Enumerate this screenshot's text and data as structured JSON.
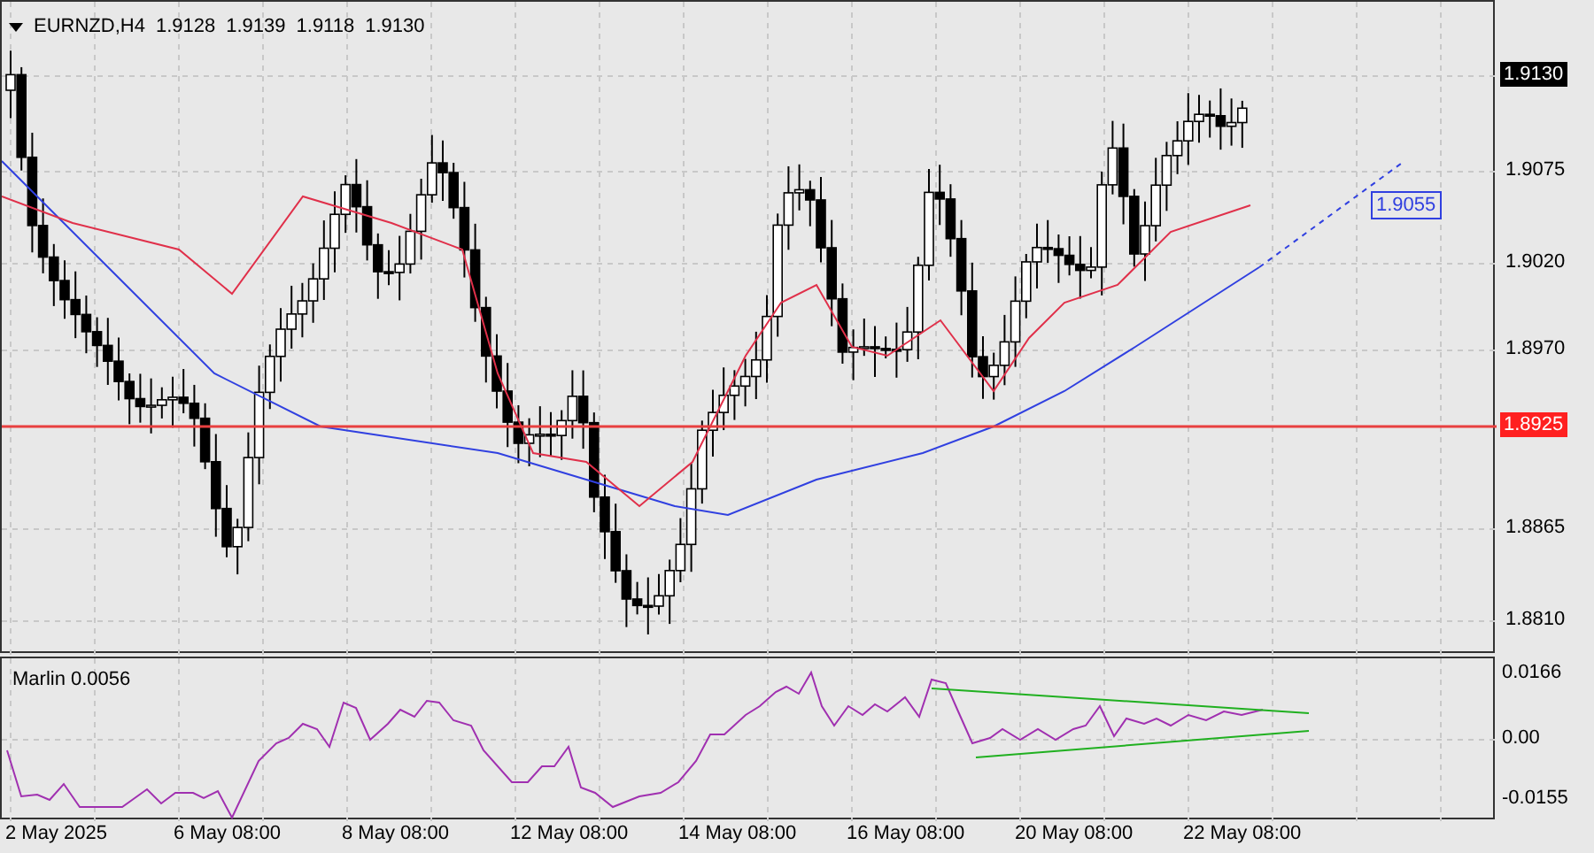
{
  "header": {
    "symbol": "EURNZD,H4",
    "ohlc": [
      "1.9128",
      "1.9139",
      "1.9118",
      "1.9130"
    ]
  },
  "price_axis": [
    "1.9075",
    "1.9020",
    "1.8970",
    "1.8865",
    "1.8810"
  ],
  "current_price": "1.9130",
  "level_line": {
    "label": "1.8925"
  },
  "trendline": {
    "label": "1.9055"
  },
  "indicator": {
    "label": "Marlin 0.0056",
    "axis": [
      "0.0166",
      "0.00",
      "-0.0155"
    ]
  },
  "time_axis": [
    "2 May 2025",
    "6 May 08:00",
    "8 May 08:00",
    "12 May 08:00",
    "14 May 08:00",
    "16 May 08:00",
    "20 May 08:00",
    "22 May 08:00"
  ]
}
